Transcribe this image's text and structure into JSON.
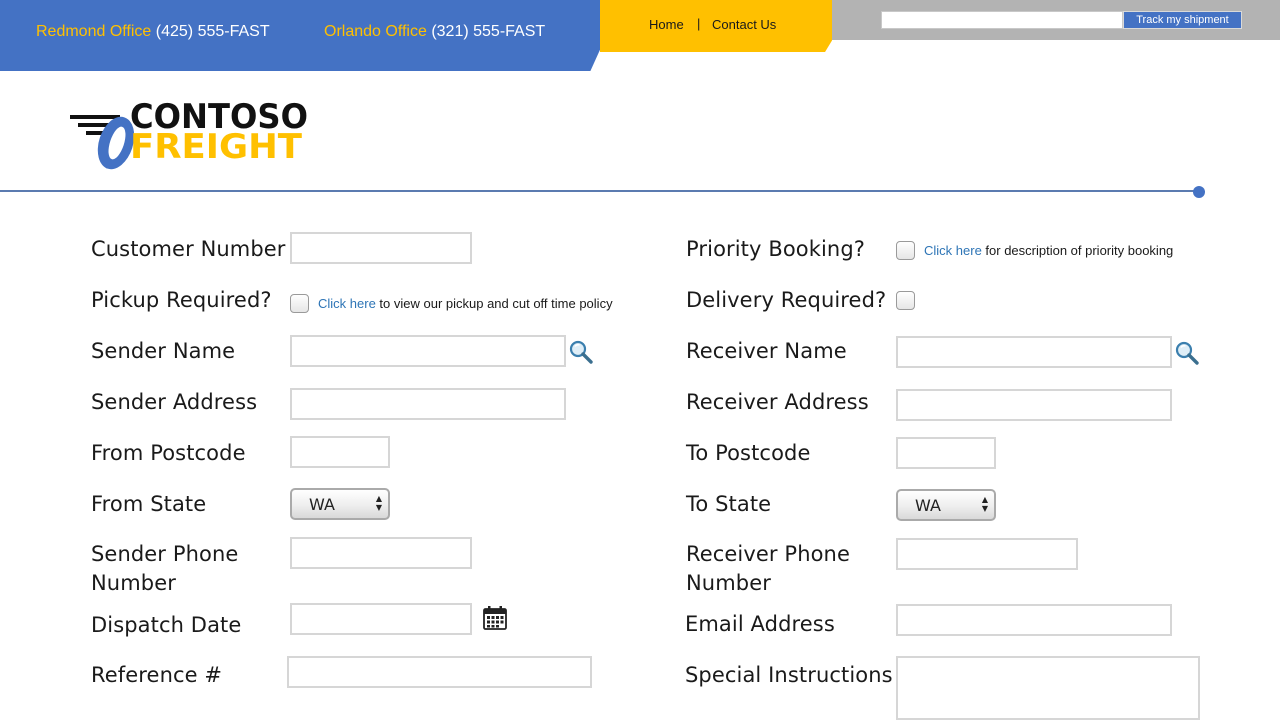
{
  "header": {
    "offices": [
      {
        "label": "Redmond Office",
        "phone": "(425) 555-FAST"
      },
      {
        "label": "Orlando Office",
        "phone": "(321) 555-FAST"
      }
    ],
    "nav": {
      "home": "Home",
      "separator": "|",
      "contact": "Contact Us"
    },
    "track": {
      "button": "Track my shipment",
      "input_value": ""
    }
  },
  "logo": {
    "line1": "CONTOSO",
    "line2": "FREIGHT"
  },
  "form": {
    "customer_number": {
      "label": "Customer Number",
      "value": ""
    },
    "priority_booking": {
      "label": "Priority Booking?",
      "checked": false,
      "link": "Click here",
      "hint": " for description of priority booking"
    },
    "pickup_required": {
      "label": "Pickup Required?",
      "checked": false,
      "link": "Click here",
      "hint": " to view our pickup and cut off time policy"
    },
    "delivery_required": {
      "label": "Delivery Required?",
      "checked": false
    },
    "sender_name": {
      "label": "Sender Name",
      "value": ""
    },
    "receiver_name": {
      "label": "Receiver Name",
      "value": ""
    },
    "sender_address": {
      "label": "Sender Address",
      "value": ""
    },
    "receiver_address": {
      "label": "Receiver Address",
      "value": ""
    },
    "from_postcode": {
      "label": "From Postcode",
      "value": ""
    },
    "to_postcode": {
      "label": "To Postcode",
      "value": ""
    },
    "from_state": {
      "label": "From State",
      "value": "WA"
    },
    "to_state": {
      "label": "To State",
      "value": "WA"
    },
    "sender_phone": {
      "label_line1": "Sender Phone",
      "label_line2": "Number",
      "value": ""
    },
    "receiver_phone": {
      "label_line1": "Receiver Phone",
      "label_line2": "Number",
      "value": ""
    },
    "dispatch_date": {
      "label": "Dispatch Date",
      "value": ""
    },
    "email_address": {
      "label": "Email Address",
      "value": ""
    },
    "reference": {
      "label": "Reference #",
      "value": ""
    },
    "special_instructions": {
      "label": "Special Instructions",
      "value": ""
    }
  },
  "icons": {
    "sender_lookup": "magnifier-icon",
    "receiver_lookup": "magnifier-icon",
    "dispatch_calendar": "calendar-icon"
  },
  "colors": {
    "brand_blue": "#4472c4",
    "brand_yellow": "#ffc000",
    "top_gray": "#b3b3b3",
    "link": "#2e75b6"
  }
}
